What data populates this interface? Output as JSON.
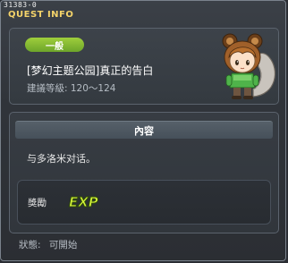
{
  "window": {
    "id_label": "31383-0",
    "title": "QUEST INFO"
  },
  "quest": {
    "difficulty": "一般",
    "title": "[梦幻主题公园]真正的告白",
    "level_range": "建議等級: 120～124"
  },
  "content": {
    "header": "內容",
    "text": "与多洛米对话。"
  },
  "reward": {
    "label": "獎勵",
    "icon": "exp-icon",
    "icon_text": "EXP"
  },
  "status": {
    "label": "狀態:",
    "value": "可開始"
  },
  "colors": {
    "title": "#f4d36a",
    "badge": "#8cc434",
    "exp_fill": "#d6f53a"
  }
}
